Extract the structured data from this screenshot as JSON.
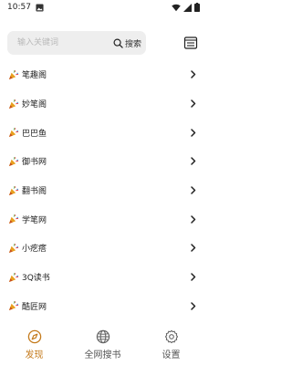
{
  "status_bar": {
    "time": "10:57"
  },
  "search": {
    "placeholder": "输入关键词",
    "button_label": "搜索"
  },
  "sources": [
    {
      "label": "笔趣阁"
    },
    {
      "label": "妙笔阁"
    },
    {
      "label": "巴巴鱼"
    },
    {
      "label": "御书网"
    },
    {
      "label": "翻书阁"
    },
    {
      "label": "学笔网"
    },
    {
      "label": "小疙瘩"
    },
    {
      "label": "3Q读书"
    },
    {
      "label": "酷匠网"
    }
  ],
  "bottom_nav": {
    "tabs": [
      {
        "label": "发现",
        "icon": "compass-icon",
        "active": true
      },
      {
        "label": "全网搜书",
        "icon": "globe-icon",
        "active": false
      },
      {
        "label": "设置",
        "icon": "gear-icon",
        "active": false
      }
    ]
  },
  "colors": {
    "accent": "#c47a1b",
    "search_bg": "#eeeeee",
    "text": "#222222"
  }
}
